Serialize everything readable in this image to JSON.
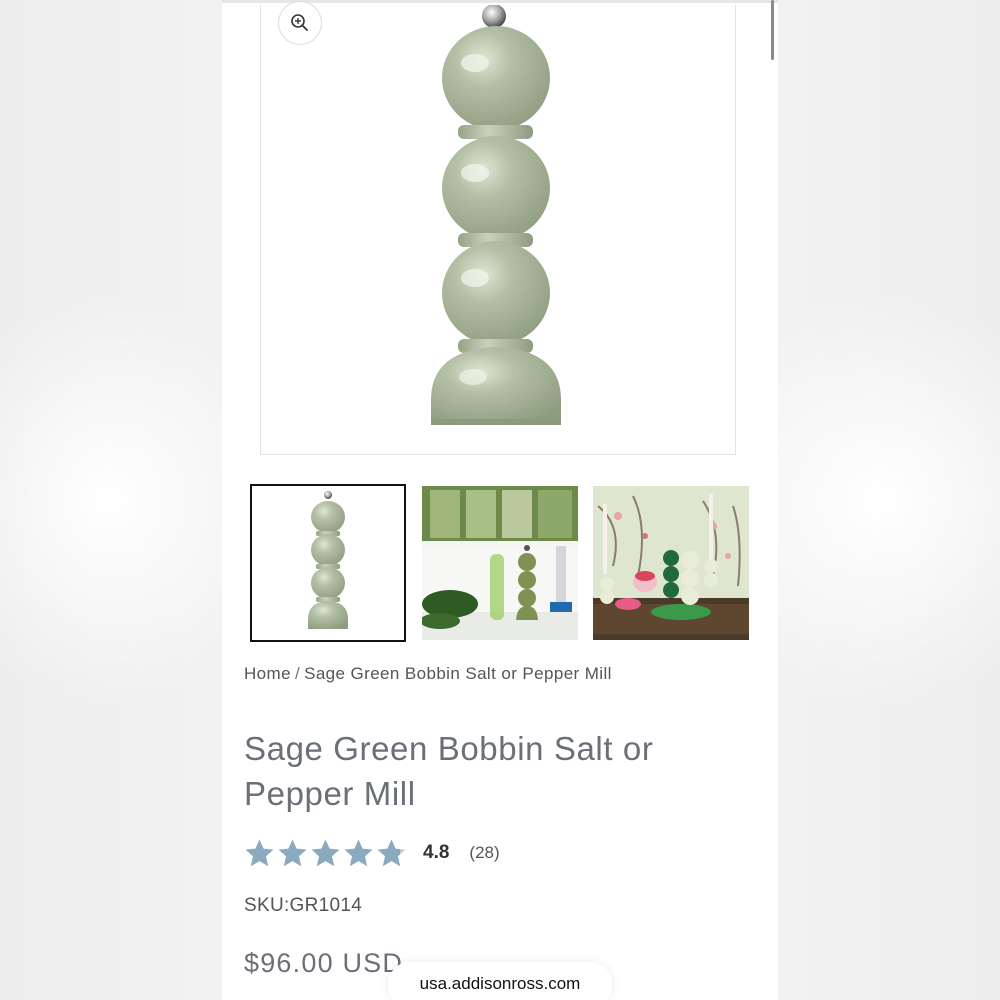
{
  "breadcrumb": {
    "home": "Home",
    "separator": "/",
    "current": "Sage Green Bobbin Salt or Pepper Mill"
  },
  "product": {
    "title": "Sage Green Bobbin Salt or Pepper Mill",
    "rating_value": "4.8",
    "rating_count": "(28)",
    "rating_stars": 4.8,
    "sku": "SKU:GR1014",
    "price": "$96.00 USD"
  },
  "gallery": {
    "zoom_icon": "zoom-in-icon",
    "thumbnails": [
      "product-only",
      "kitchen-scene",
      "dining-scene"
    ],
    "selected_index": 0
  },
  "browser": {
    "url": "usa.addisonross.com"
  },
  "colors": {
    "sage_green": "#a9b59b",
    "star_blue": "#8aaabf",
    "title_gray": "#6b6f78"
  }
}
